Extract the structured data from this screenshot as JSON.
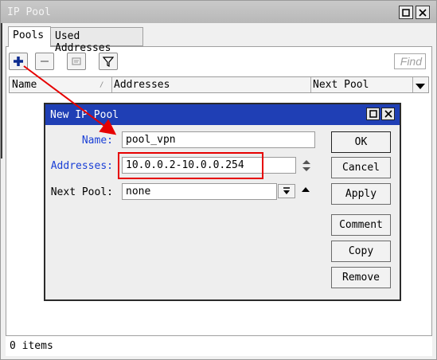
{
  "window": {
    "title": "IP Pool",
    "tabs": [
      {
        "label": "Pools",
        "active": true
      },
      {
        "label": "Used Addresses",
        "active": false
      }
    ],
    "toolbar": {
      "add_icon": "plus-icon",
      "remove_icon": "minus-icon",
      "comment_icon": "note-icon",
      "filter_icon": "filter-icon",
      "find_placeholder": "Find"
    },
    "columns": [
      "Name",
      "Addresses",
      "Next Pool"
    ],
    "status": "0 items"
  },
  "dialog": {
    "title": "New IP Pool",
    "fields": {
      "name_label": "Name:",
      "name_value": "pool_vpn",
      "addresses_label": "Addresses:",
      "addresses_value": "10.0.0.2-10.0.0.254",
      "next_pool_label": "Next Pool:",
      "next_pool_value": "none"
    },
    "buttons": {
      "ok": "OK",
      "cancel": "Cancel",
      "apply": "Apply",
      "comment": "Comment",
      "copy": "Copy",
      "remove": "Remove"
    }
  },
  "colors": {
    "dialog_titlebar": "#1f3fb5",
    "label_blue": "#1a3fd6",
    "annotation_red": "#e60000"
  }
}
